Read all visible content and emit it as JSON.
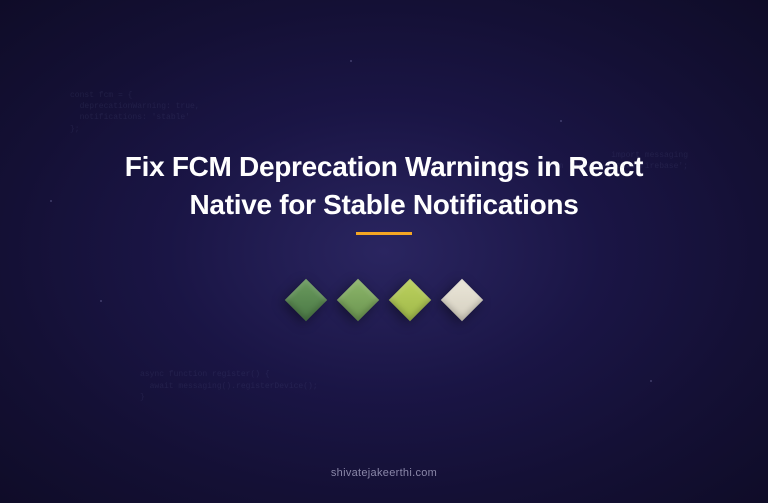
{
  "title": "Fix FCM Deprecation Warnings in React Native for Stable Notifications",
  "footer": "shivatejakeerthi.com",
  "diamonds": {
    "colors": [
      "#5a8a52",
      "#7ba55d",
      "#aec456",
      "#e2ddcd"
    ]
  }
}
